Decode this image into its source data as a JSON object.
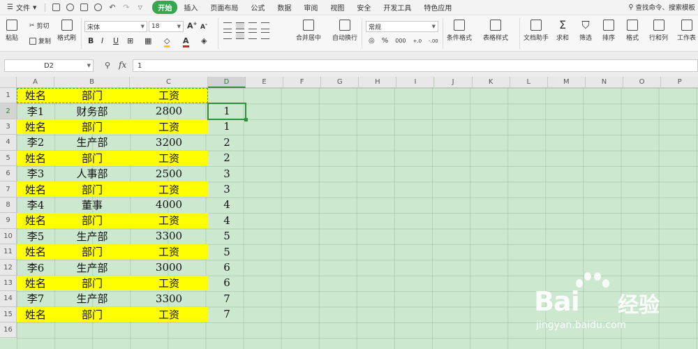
{
  "menubar": {
    "file_label": "文件",
    "tabs": [
      "开始",
      "插入",
      "页面布局",
      "公式",
      "数据",
      "审阅",
      "视图",
      "安全",
      "开发工具",
      "特色应用"
    ],
    "search_label": "查找命令、搜索模板"
  },
  "ribbon": {
    "paste": "粘贴",
    "cut": "剪切",
    "copy": "复制",
    "format_painter": "格式刷",
    "font_name": "宋体",
    "font_size": "18",
    "merge_center": "合并居中",
    "wrap_text": "自动换行",
    "number_format": "常规",
    "conditional_format": "条件格式",
    "table_style": "表格样式",
    "doc_assistant": "文档助手",
    "sum": "求和",
    "filter": "筛选",
    "sort": "排序",
    "format": "格式",
    "row_col": "行和列",
    "worksheet": "工作表"
  },
  "formula_bar": {
    "name_box": "D2",
    "fx": "fx",
    "value": "1"
  },
  "sheet": {
    "columns": [
      "A",
      "B",
      "C",
      "D",
      "E",
      "F",
      "G",
      "H",
      "I",
      "J",
      "K",
      "L",
      "M",
      "N",
      "O",
      "P"
    ],
    "rows": [
      "1",
      "2",
      "3",
      "4",
      "5",
      "6",
      "7",
      "8",
      "9",
      "10",
      "11",
      "12",
      "13",
      "14",
      "15",
      "16"
    ],
    "selected_column": "D",
    "selected_row": "2",
    "cells": [
      {
        "a": "姓名",
        "b": "部门",
        "c": "工资",
        "d": "",
        "hl": true
      },
      {
        "a": "李1",
        "b": "财务部",
        "c": "2800",
        "d": "1",
        "hl": false
      },
      {
        "a": "姓名",
        "b": "部门",
        "c": "工资",
        "d": "1",
        "hl": true
      },
      {
        "a": "李2",
        "b": "生产部",
        "c": "3200",
        "d": "2",
        "hl": false
      },
      {
        "a": "姓名",
        "b": "部门",
        "c": "工资",
        "d": "2",
        "hl": true
      },
      {
        "a": "李3",
        "b": "人事部",
        "c": "2500",
        "d": "3",
        "hl": false
      },
      {
        "a": "姓名",
        "b": "部门",
        "c": "工资",
        "d": "3",
        "hl": true
      },
      {
        "a": "李4",
        "b": "董事",
        "c": "4000",
        "d": "4",
        "hl": false
      },
      {
        "a": "姓名",
        "b": "部门",
        "c": "工资",
        "d": "4",
        "hl": true
      },
      {
        "a": "李5",
        "b": "生产部",
        "c": "3300",
        "d": "5",
        "hl": false
      },
      {
        "a": "姓名",
        "b": "部门",
        "c": "工资",
        "d": "5",
        "hl": true
      },
      {
        "a": "李6",
        "b": "生产部",
        "c": "3000",
        "d": "6",
        "hl": false
      },
      {
        "a": "姓名",
        "b": "部门",
        "c": "工资",
        "d": "6",
        "hl": true
      },
      {
        "a": "李7",
        "b": "生产部",
        "c": "3300",
        "d": "7",
        "hl": false
      },
      {
        "a": "姓名",
        "b": "部门",
        "c": "工资",
        "d": "7",
        "hl": true
      }
    ]
  },
  "watermark": {
    "brand_latin": "Bai",
    "brand_cn": "经验",
    "url": "jingyan.baidu.com"
  },
  "colors": {
    "accent": "#36a64f",
    "sheet_bg": "#cce8cf",
    "highlight": "#ffff00",
    "selection": "#2f8f3d"
  }
}
